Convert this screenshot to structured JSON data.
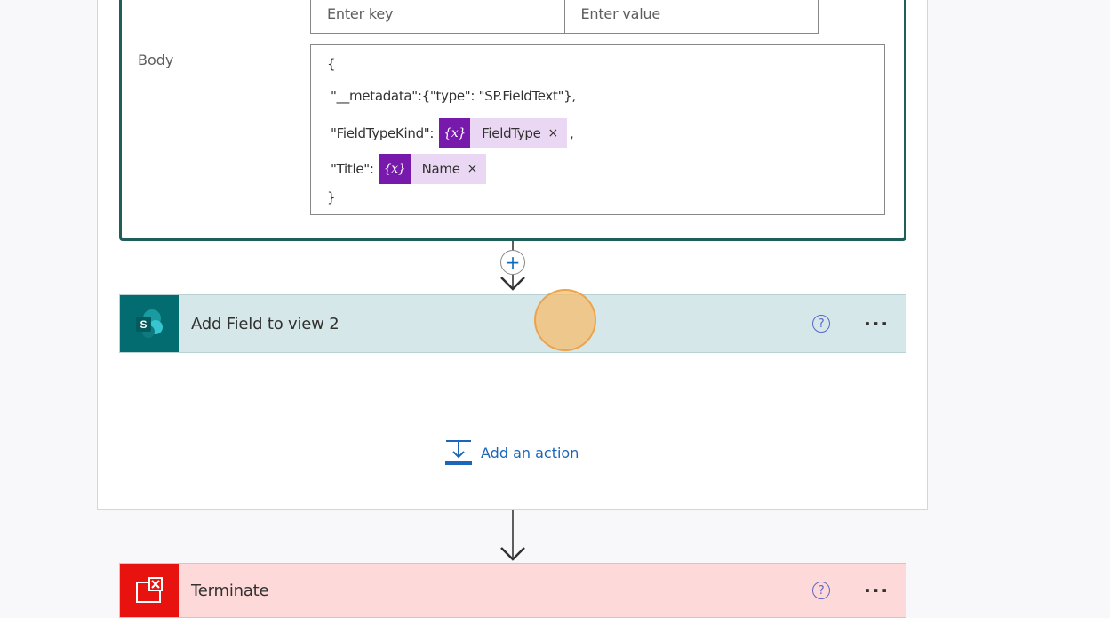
{
  "http_card": {
    "headers": {
      "key_placeholder": "Enter key",
      "value_placeholder": "Enter value"
    },
    "body_label": "Body",
    "body_lines": {
      "open": "{",
      "metadata": "\"__metadata\":{\"type\": \"SP.FieldText\"},",
      "fieldtypekind_label": "\"FieldTypeKind\":",
      "fieldtypekind_token": {
        "icon": "{x}",
        "text": "FieldType",
        "remove": "×"
      },
      "fieldtypekind_suffix": ",",
      "title_label": "\"Title\":",
      "title_token": {
        "icon": "{x}",
        "text": "Name",
        "remove": "×"
      },
      "close": "}"
    }
  },
  "insert_step": {
    "label": "+"
  },
  "sharepoint_action": {
    "title": "Add Field to view 2",
    "help": "?",
    "more": "···",
    "icon": "sharepoint-icon",
    "accent": "#036c70"
  },
  "add_action": {
    "label": "Add an action",
    "icon": "add-action-icon"
  },
  "terminate_action": {
    "title": "Terminate",
    "help": "?",
    "more": "···",
    "icon": "terminate-icon",
    "accent": "#e8130e"
  }
}
